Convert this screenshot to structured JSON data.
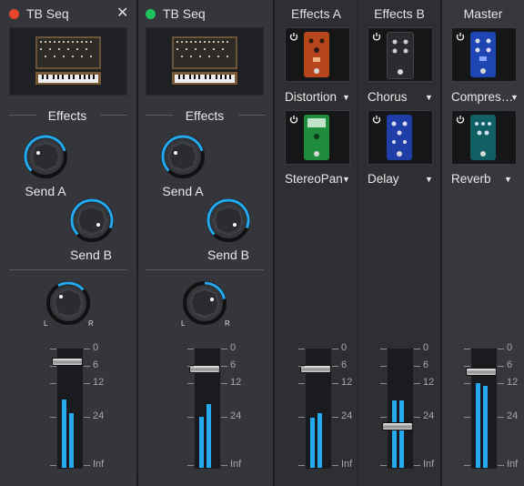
{
  "channels": [
    {
      "title": "TB Seq",
      "dot_color": "#e8452c",
      "close_icon": "✕",
      "effects_label": "Effects",
      "send_a": "Send A",
      "send_b": "Send B",
      "pan_l": "L",
      "pan_r": "R"
    },
    {
      "title": "TB Seq",
      "dot_color": "#1fc15c",
      "effects_label": "Effects",
      "send_a": "Send A",
      "send_b": "Send B",
      "pan_l": "L",
      "pan_r": "R"
    }
  ],
  "fx_buses": [
    {
      "title": "Effects A",
      "slots": [
        {
          "name": "Distortion",
          "pedal_color": "#b8461c"
        },
        {
          "name": "StereoPan",
          "pedal_color": "#1f8d3b"
        }
      ]
    },
    {
      "title": "Effects B",
      "slots": [
        {
          "name": "Chorus",
          "pedal_color": "#2a2b2e"
        },
        {
          "name": "Delay",
          "pedal_color": "#1f3ea8"
        }
      ]
    },
    {
      "title": "Master",
      "slots": [
        {
          "name": "Compres…",
          "pedal_color": "#1d46b2"
        },
        {
          "name": "Reverb",
          "pedal_color": "#0f5f63"
        }
      ]
    }
  ],
  "fader_scale": [
    "0",
    "6",
    "12",
    "24",
    "Inf"
  ],
  "accent_color": "#25aaf0",
  "caret": "▼"
}
